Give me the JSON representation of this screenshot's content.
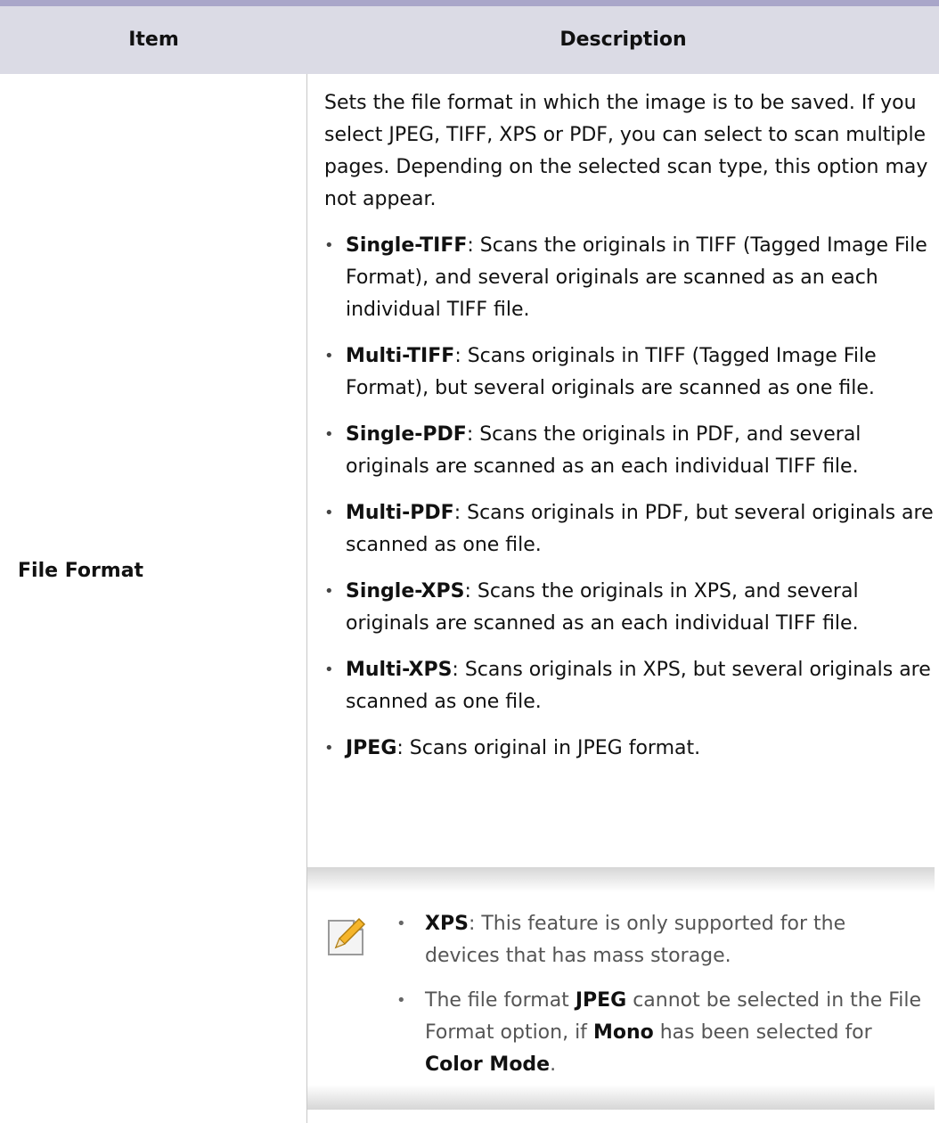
{
  "table": {
    "headers": {
      "item": "Item",
      "description": "Description"
    },
    "row": {
      "item": "File Format",
      "intro": "Sets the file format in which the image is to be saved. If you select JPEG, TIFF, XPS or PDF, you can select to scan multiple pages. Depending on the selected scan type, this option may not appear.",
      "bullets": [
        {
          "term": "Single-TIFF",
          "text": ": Scans the originals in TIFF (Tagged Image File Format), and several originals are scanned as an each individual TIFF file."
        },
        {
          "term": "Multi-TIFF",
          "text": ": Scans originals in TIFF (Tagged Image File Format), but several originals are scanned as one file."
        },
        {
          "term": "Single-PDF",
          "text": ": Scans the originals in PDF, and several originals are scanned as an each individual TIFF file."
        },
        {
          "term": "Multi-PDF",
          "text": ": Scans originals in PDF, but several originals are scanned as one file."
        },
        {
          "term": "Single-XPS",
          "text": ": Scans the originals in XPS, and several originals are scanned as an each individual TIFF file."
        },
        {
          "term": "Multi-XPS",
          "text": ": Scans originals in XPS, but several originals are scanned as one file."
        },
        {
          "term": "JPEG",
          "text": ": Scans original in JPEG format."
        }
      ]
    }
  },
  "note": {
    "icon": "note-pencil-icon",
    "item1": {
      "term": "XPS",
      "text": ": This feature is only supported for the devices that has mass storage."
    },
    "item2": {
      "p1": "The file format ",
      "b1": "JPEG",
      "p2": " cannot be selected in the File Format option, if ",
      "b2": "Mono",
      "p3": " has been selected for ",
      "b3": "Color Mode",
      "p4": "."
    }
  },
  "bullet_glyph": "•"
}
